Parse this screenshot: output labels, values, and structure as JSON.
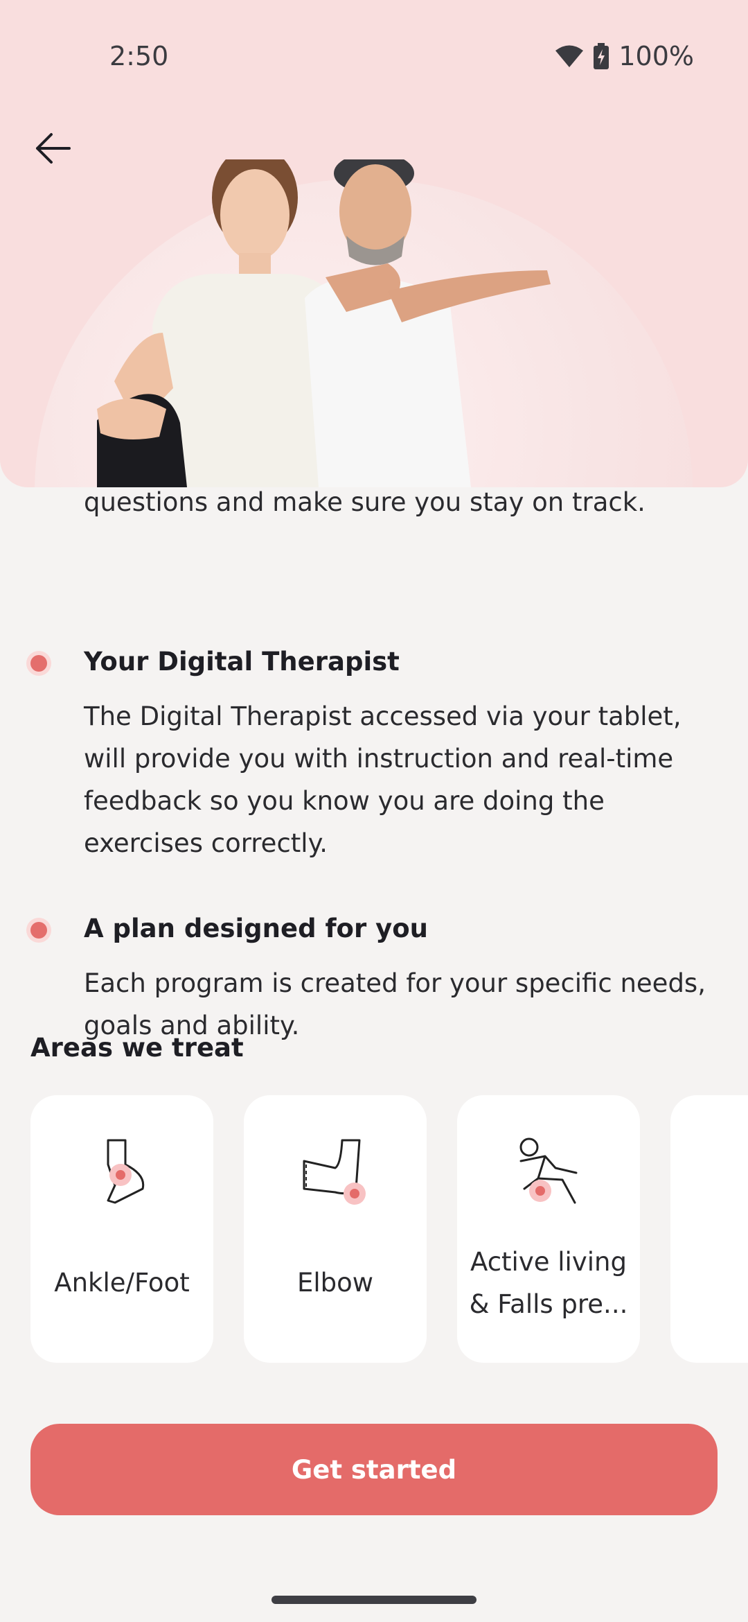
{
  "status_bar": {
    "time": "2:50",
    "battery": "100%"
  },
  "content": {
    "clipped_line": "questions and make sure you stay on track.",
    "features": [
      {
        "title": "Your Digital Therapist",
        "description": "The Digital Therapist accessed via your tablet, will provide you with instruction and real-time feedback so you know you are doing the exercises correctly."
      },
      {
        "title": "A plan designed for you",
        "description": "Each program is created for your specific needs, goals and ability."
      }
    ]
  },
  "areas": {
    "title": "Areas we treat",
    "items": [
      {
        "label": "Ankle/Foot",
        "icon": "ankle-foot-icon"
      },
      {
        "label": "Elbow",
        "icon": "elbow-icon"
      },
      {
        "label": "Active living & Falls pre...",
        "icon": "falls-prevention-icon"
      }
    ]
  },
  "cta": {
    "label": "Get started"
  },
  "colors": {
    "accent": "#e46b69",
    "hero_bg": "#f9dede",
    "page_bg": "#f5f3f2"
  }
}
